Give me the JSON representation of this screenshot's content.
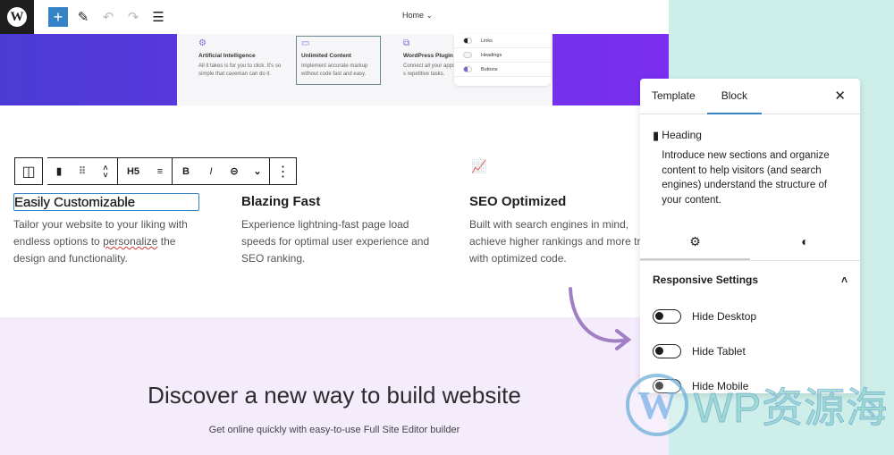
{
  "topbar": {
    "page": "Home",
    "icons": [
      "wordpress-logo",
      "plus-icon",
      "pencil-icon",
      "undo-icon",
      "redo-icon",
      "list-view-icon"
    ]
  },
  "preview": {
    "cards": [
      {
        "title": "Artificial Intelligence",
        "text": "All it takes is for you to click. It's so simple that caveman can do it.",
        "icon": "gear-icon"
      },
      {
        "title": "Unlimited Content",
        "text": "Implement accurate markup without code fast and easy.",
        "icon": "browser-icon"
      },
      {
        "title": "WordPress Plugin",
        "text": "Connect all your apps, s repetitive tasks.",
        "icon": "plugin-icon"
      }
    ],
    "toggles": [
      "Links",
      "Headings",
      "Buttons"
    ]
  },
  "block_toolbar": {
    "heading_level": "H5",
    "bold": "B",
    "italic": "I",
    "more": "⋮"
  },
  "features": [
    {
      "title": "Easily Customizable",
      "text_before": "Tailor your website to your liking with endless options to ",
      "misspelled": "personalize",
      "text_after": " the design and functionality."
    },
    {
      "title": "Blazing Fast",
      "text": "Experience lightning-fast page load speeds for optimal user experience and SEO ranking."
    },
    {
      "title": "SEO Optimized",
      "text": "Built with search engines in mind, achieve higher rankings and more traffic with optimized code."
    }
  ],
  "cta": {
    "title": "Discover a new way to build website",
    "subtitle": "Get online quickly with easy-to-use Full Site Editor builder"
  },
  "panel": {
    "tabs": [
      "Template",
      "Block"
    ],
    "active_tab": "Block",
    "block_name": "Heading",
    "block_desc": "Introduce new sections and organize content to help visitors (and search engines) understand the structure of your content.",
    "section": "Responsive Settings",
    "options": [
      {
        "label": "Hide Desktop",
        "on": false
      },
      {
        "label": "Hide Tablet",
        "on": false
      },
      {
        "label": "Hide Mobile",
        "on": false
      }
    ]
  },
  "watermark": "WP资源海",
  "colors": {
    "accent": "#3582c4",
    "purple": "#7b2ff0",
    "lavender": "#f4ebfb",
    "teal": "#cdeee9"
  }
}
